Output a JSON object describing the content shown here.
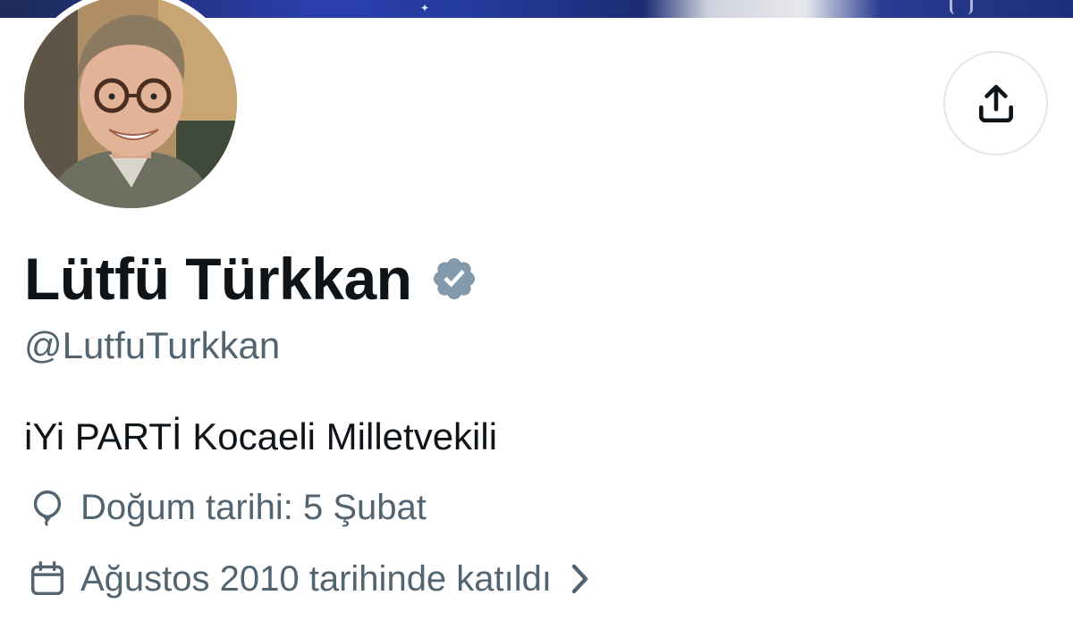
{
  "profile": {
    "display_name": "Lütfü Türkkan",
    "handle": "@LutfuTurkkan",
    "bio": "iYi PARTİ Kocaeli Milletvekili",
    "birthday": "Doğum tarihi: 5 Şubat",
    "joined": "Ağustos 2010 tarihinde katıldı",
    "verified_badge_color": "#829aab"
  },
  "icons": {
    "share": "share-upload-icon",
    "verified": "verified-badge-icon",
    "birthday": "balloon-icon",
    "joined": "calendar-icon",
    "joined_chevron": "chevron-right-icon"
  },
  "colors": {
    "text_primary": "#0f1419",
    "text_secondary": "#536471",
    "border": "#e1e6ea"
  }
}
